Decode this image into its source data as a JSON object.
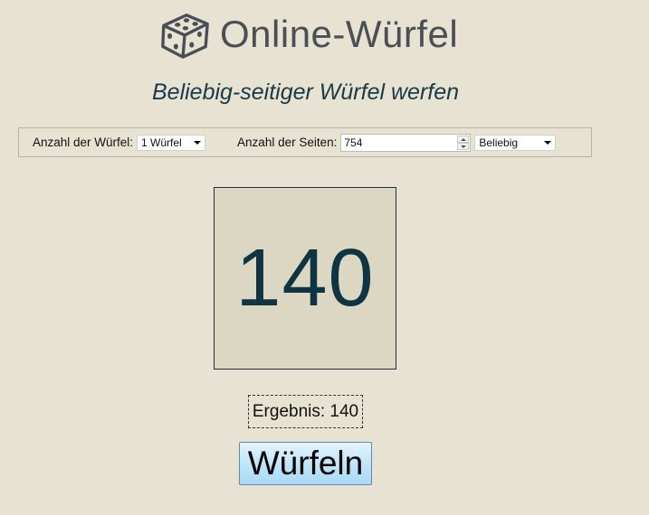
{
  "header": {
    "title": "Online-Würfel",
    "logo_icon": "dice-icon"
  },
  "subtitle": "Beliebig-seitiger Würfel werfen",
  "controls": {
    "dice_count_label": "Anzahl der Würfel:",
    "dice_count_value": "1 Würfel",
    "sides_label": "Anzahl der Seiten:",
    "sides_value": "754",
    "type_value": "Beliebig"
  },
  "die": {
    "value": "140"
  },
  "result": {
    "text": "Ergebnis: 140"
  },
  "roll_button": {
    "label": "Würfeln"
  },
  "colors": {
    "background": "#e7e2d1",
    "die_face": "#dbd7c3",
    "die_text": "#0f3442",
    "subtitle": "#1a3a4a",
    "button_accent": "#bfe4f8"
  }
}
